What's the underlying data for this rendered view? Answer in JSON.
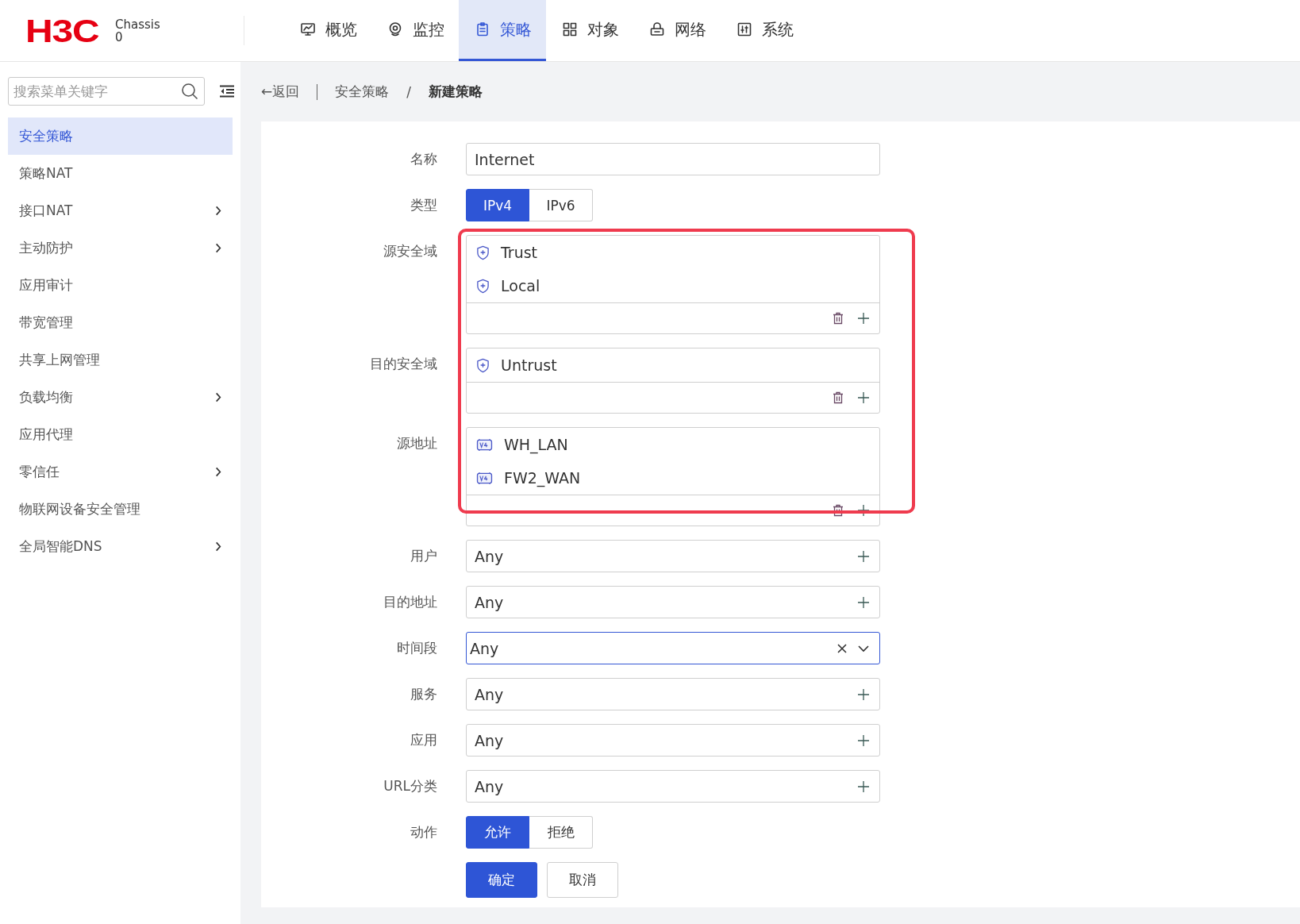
{
  "header": {
    "logo": "H3C",
    "device": [
      "Chassis",
      "0"
    ],
    "nav": [
      {
        "label": "概览",
        "selected": false
      },
      {
        "label": "监控",
        "selected": false
      },
      {
        "label": "策略",
        "selected": true
      },
      {
        "label": "对象",
        "selected": false
      },
      {
        "label": "网络",
        "selected": false
      },
      {
        "label": "系统",
        "selected": false
      }
    ]
  },
  "sidebar": {
    "search": {
      "placeholder": "搜索菜单关键字"
    },
    "items": [
      {
        "label": "安全策略",
        "selected": true,
        "has_submenu": false
      },
      {
        "label": "策略NAT",
        "selected": false,
        "has_submenu": false
      },
      {
        "label": "接口NAT",
        "selected": false,
        "has_submenu": true
      },
      {
        "label": "主动防护",
        "selected": false,
        "has_submenu": true
      },
      {
        "label": "应用审计",
        "selected": false,
        "has_submenu": false
      },
      {
        "label": "带宽管理",
        "selected": false,
        "has_submenu": false
      },
      {
        "label": "共享上网管理",
        "selected": false,
        "has_submenu": false
      },
      {
        "label": "负载均衡",
        "selected": false,
        "has_submenu": true
      },
      {
        "label": "应用代理",
        "selected": false,
        "has_submenu": false
      },
      {
        "label": "零信任",
        "selected": false,
        "has_submenu": true
      },
      {
        "label": "物联网设备安全管理",
        "selected": false,
        "has_submenu": false
      },
      {
        "label": "全局智能DNS",
        "selected": false,
        "has_submenu": true
      }
    ]
  },
  "breadcrumb": {
    "back": "←返回",
    "path": [
      "安全策略",
      "新建策略"
    ],
    "separator": "/"
  },
  "form": {
    "rows": [
      {
        "kind": "text",
        "label": "名称",
        "value": "Internet"
      },
      {
        "kind": "segmented",
        "label": "类型",
        "options": [
          {
            "label": "IPv4",
            "selected": true
          },
          {
            "label": "IPv6",
            "selected": false
          }
        ]
      },
      {
        "kind": "multi",
        "label": "源安全域",
        "highlighted": true,
        "items": [
          {
            "label": "Trust",
            "kind": "zone"
          },
          {
            "label": "Local",
            "kind": "zone"
          }
        ]
      },
      {
        "kind": "multi",
        "label": "目的安全域",
        "highlighted": true,
        "items": [
          {
            "label": "Untrust",
            "kind": "zone"
          }
        ]
      },
      {
        "kind": "multi",
        "label": "源地址",
        "highlighted": true,
        "items": [
          {
            "label": "WH_LAN",
            "kind": "address"
          },
          {
            "label": "FW2_WAN",
            "kind": "address"
          }
        ]
      },
      {
        "kind": "add",
        "label": "用户",
        "value": "Any"
      },
      {
        "kind": "add",
        "label": "目的地址",
        "value": "Any"
      },
      {
        "kind": "select",
        "label": "时间段",
        "value": "Any",
        "focused": true
      },
      {
        "kind": "add",
        "label": "服务",
        "value": "Any"
      },
      {
        "kind": "add",
        "label": "应用",
        "value": "Any"
      },
      {
        "kind": "add",
        "label": "URL分类",
        "value": "Any"
      },
      {
        "kind": "segmented",
        "label": "动作",
        "options": [
          {
            "label": "允许",
            "selected": true
          },
          {
            "label": "拒绝",
            "selected": false
          }
        ]
      }
    ],
    "buttons": [
      {
        "label": "确定",
        "primary": true
      },
      {
        "label": "取消",
        "primary": false
      }
    ]
  }
}
